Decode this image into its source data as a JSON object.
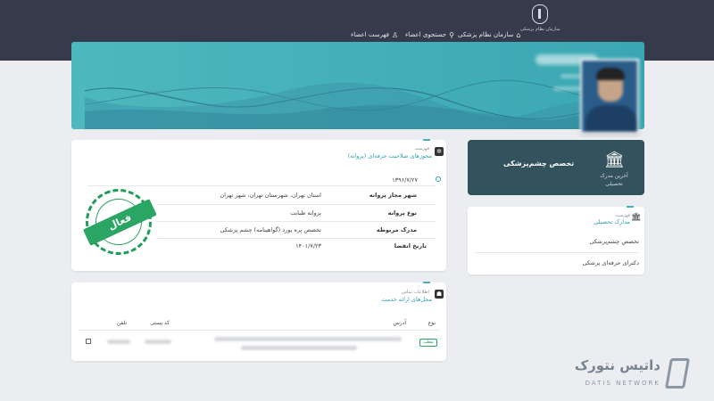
{
  "header": {
    "logo_text": "سازمان نظام پزشکی",
    "nav": [
      {
        "label": "سازمان نظام پزشکی",
        "icon": "home-icon"
      },
      {
        "label": "جستجوی اعضاء",
        "icon": "search-icon"
      },
      {
        "label": "فهرست اعضاء",
        "icon": "user-icon"
      }
    ]
  },
  "specialty_card": {
    "title": "تخصص چشم‌پزشکی",
    "subtitle": "آخرین مدرک تحصیلی",
    "icon": "bank-icon"
  },
  "license_card": {
    "section_sub": "فهرست",
    "section_title": "مجوزهای صلاحیت حرفه‌ای (پروانه)",
    "date": "۱۳۹۶/۷/۲۷",
    "rows": [
      {
        "label": "شهر مجاز پروانه",
        "value": "استان تهران، شهرستان تهران، شهر تهران"
      },
      {
        "label": "نوع پروانه",
        "value": "پروانه طبابت"
      },
      {
        "label": "مدرک مربوطه",
        "value": "تخصص پره بورد (گواهینامه) چشم پزشکی"
      },
      {
        "label": "تاریخ انقضا",
        "value": "۱۴۰۱/۷/۲۳"
      }
    ],
    "stamp_text": "فعال"
  },
  "education_card": {
    "section_sub": "فهرست",
    "section_title": "مدارک تحصیلی",
    "items": [
      "تخصص چشم‌پزشکی",
      "دکترای حرفه‌ای پزشکی"
    ]
  },
  "service_card": {
    "section_sub": "اطلاعات تماس",
    "section_title": "محل‌های ارائه خدمت",
    "columns": {
      "type": "نوع",
      "address": "آدرس",
      "postal": "کد پستی",
      "phone": "تلفن"
    },
    "row_badge": "مطب"
  },
  "watermark": {
    "title": "داتیس نتورک",
    "subtitle": "DATIS NETWORK"
  },
  "colors": {
    "topbar": "#353b4b",
    "teal": "#45b3b9",
    "accent_text": "#2e9fb5",
    "spec_card": "#34525d",
    "stamp_green": "#2aa563"
  }
}
